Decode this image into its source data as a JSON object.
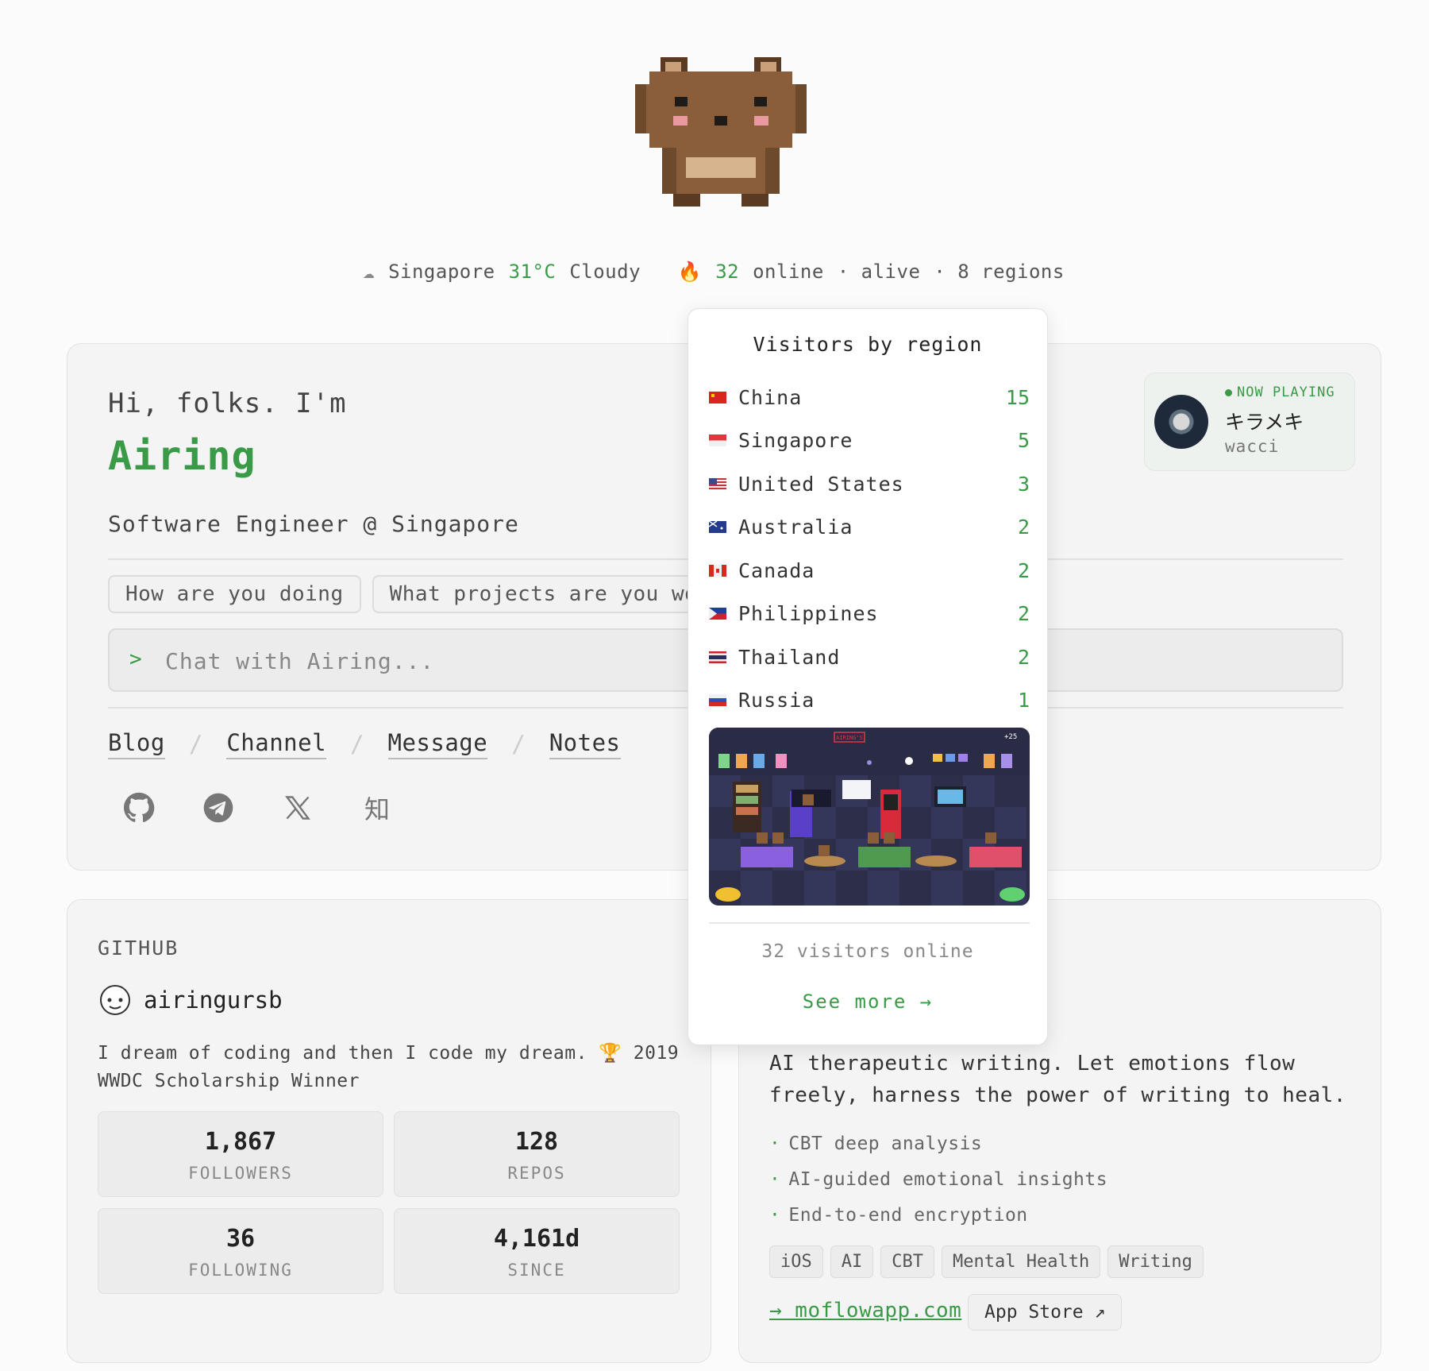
{
  "status": {
    "weather_icon": "cloud-icon",
    "city": "Singapore",
    "temperature": "31°C",
    "condition": "Cloudy",
    "fire_icon": "fire-icon",
    "online_count": "32",
    "online_label": "online",
    "alive_label": "· alive",
    "regions_label": "· 8 regions"
  },
  "intro": {
    "greeting": "Hi, folks. I'm",
    "name": "Airing",
    "role": "Software Engineer @ Singapore"
  },
  "suggestions": [
    "How are you doing",
    "What projects are you working on"
  ],
  "chat": {
    "prompt": ">",
    "placeholder": "Chat with Airing..."
  },
  "nav": {
    "links": [
      "Blog",
      "Channel",
      "Message",
      "Notes"
    ],
    "separator": "/"
  },
  "socials": [
    "github-icon",
    "telegram-icon",
    "x-icon",
    "zhihu-icon"
  ],
  "zhihu_glyph": "知",
  "now_playing": {
    "label": "NOW PLAYING",
    "title": "キラメキ",
    "artist": "wacci"
  },
  "github": {
    "heading": "GITHUB",
    "username": "airingursb",
    "bio": "I dream of coding and then I code my dream. 🏆 2019 WWDC Scholarship Winner ",
    "stats": [
      {
        "value": "1,867",
        "label": "FOLLOWERS"
      },
      {
        "value": "128",
        "label": "REPOS"
      },
      {
        "value": "36",
        "label": "FOLLOWING"
      },
      {
        "value": "4,161d",
        "label": "SINCE"
      }
    ]
  },
  "project": {
    "description": "AI therapeutic writing. Let emotions flow freely, harness the power of writing to heal.",
    "features": [
      "CBT deep analysis",
      "AI-guided emotional insights",
      "End-to-end encryption"
    ],
    "tags": [
      "iOS",
      "AI",
      "CBT",
      "Mental Health",
      "Writing"
    ],
    "link": "→ moflowapp.com",
    "app_store": "App Store ↗"
  },
  "visitors_popover": {
    "title": "Visitors by region",
    "regions": [
      {
        "name": "China",
        "count": "15"
      },
      {
        "name": "Singapore",
        "count": "5"
      },
      {
        "name": "United States",
        "count": "3"
      },
      {
        "name": "Australia",
        "count": "2"
      },
      {
        "name": "Canada",
        "count": "2"
      },
      {
        "name": "Philippines",
        "count": "2"
      },
      {
        "name": "Thailand",
        "count": "2"
      },
      {
        "name": "Russia",
        "count": "1"
      }
    ],
    "room_sign": "AIRING'S",
    "room_counter": "+25",
    "visitors_text": "32 visitors online",
    "see_more": "See more →"
  },
  "colors": {
    "accent": "#3a9a47",
    "card_bg": "#f4f4f4",
    "page_bg": "#fbfbfb"
  }
}
